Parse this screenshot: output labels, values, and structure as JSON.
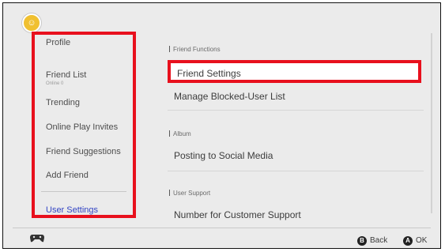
{
  "user": {
    "avatar_icon": "avatar-icon",
    "avatar_color": "#f0c030"
  },
  "sidebar": {
    "items": [
      {
        "label": "Profile"
      },
      {
        "label": "Friend List",
        "sub": "Online 0"
      },
      {
        "label": "Trending"
      },
      {
        "label": "Online Play Invites"
      },
      {
        "label": "Friend Suggestions"
      },
      {
        "label": "Add Friend"
      },
      {
        "label": "User Settings",
        "active": true
      }
    ]
  },
  "main": {
    "sections": [
      {
        "header": "Friend Functions",
        "items": [
          "Friend Settings",
          "Manage Blocked-User List"
        ]
      },
      {
        "header": "Album",
        "items": [
          "Posting to Social Media"
        ]
      },
      {
        "header": "User Support",
        "items": [
          "Number for Customer Support"
        ]
      }
    ],
    "selected_item": "Friend Settings"
  },
  "footer": {
    "controller_icon": "controller-icon",
    "b_button": "B",
    "back_label": "Back",
    "a_button": "A",
    "ok_label": "OK"
  },
  "colors": {
    "highlight": "#e8101d",
    "active_text": "#3446c4",
    "background": "#ebebeb"
  }
}
